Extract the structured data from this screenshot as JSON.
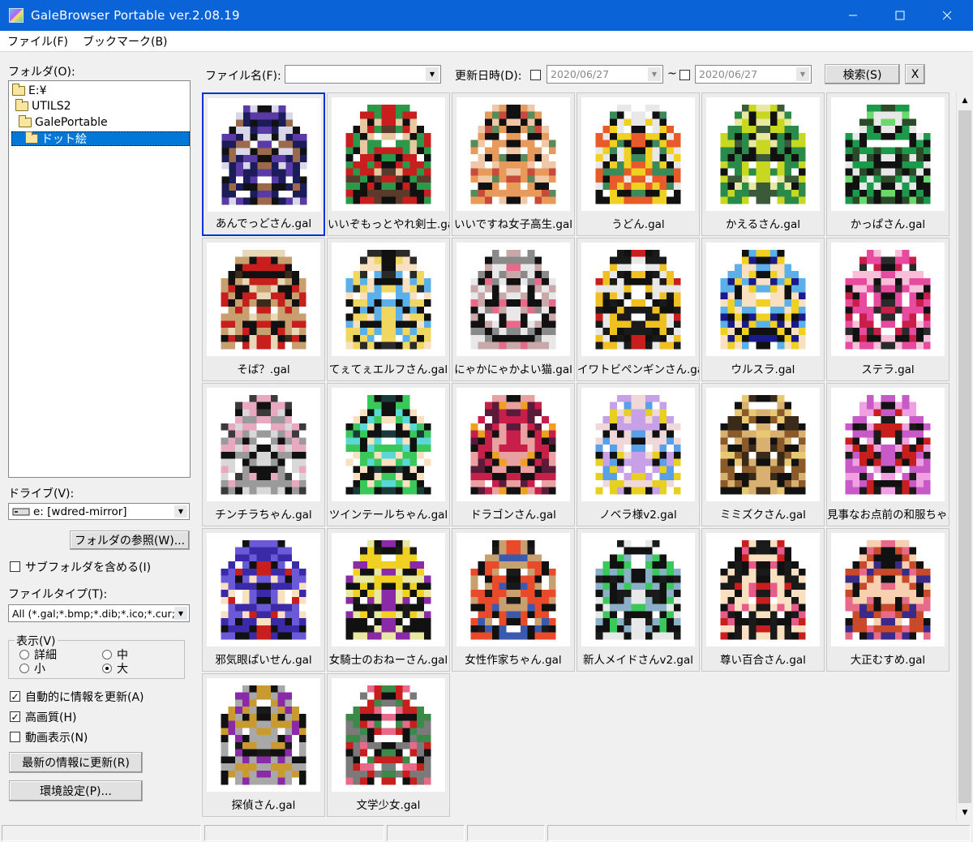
{
  "window": {
    "title": "GaleBrowser Portable ver.2.08.19",
    "minimize": "—",
    "maximize": "☐",
    "close": "✕"
  },
  "menu": [
    "ファイル(F)",
    "ブックマーク(B)"
  ],
  "left": {
    "folder_label": "フォルダ(O):",
    "tree": [
      "E:¥",
      "UTILS2",
      "GalePortable",
      "ドット絵"
    ],
    "drive_label": "ドライブ(V):",
    "drive_value": "e: [wdred-mirror]",
    "browse_button": "フォルダの参照(W)...",
    "subfolders_label": "サブフォルダを含める(I)",
    "filetype_label": "ファイルタイプ(T):",
    "filetype_value": "All (*.gal;*.bmp;*.dib;*.ico;*.cur;*",
    "display_group": "表示(V)",
    "display_options": {
      "detail": "詳細",
      "small": "小",
      "medium": "中",
      "large": "大"
    },
    "auto_update": "自動的に情報を更新(A)",
    "hq": "高画質(H)",
    "animation": "動画表示(N)",
    "refresh_button": "最新の情報に更新(R)",
    "settings_button": "環境設定(P)..."
  },
  "search": {
    "filename_label": "ファイル名(F):",
    "date_label": "更新日時(D):",
    "date_from": "2020/06/27",
    "tilde": "~",
    "date_to": "2020/06/27",
    "search_button": "検索(S)",
    "clear_button": "X"
  },
  "files": [
    {
      "name": "あんでっどさん.gal",
      "colors": [
        "#1c1c5a",
        "#5a3aa6",
        "#d8d8e8",
        "#9a6a4a"
      ]
    },
    {
      "name": "いいぞもっとやれ剣士.gal",
      "colors": [
        "#c81e1e",
        "#2a9a4a",
        "#e8c8a0",
        "#5a3a2a"
      ]
    },
    {
      "name": "いいですね女子高生.gal",
      "colors": [
        "#e89a5a",
        "#f0c8a8",
        "#5a8a5a",
        "#c84a3a"
      ]
    },
    {
      "name": "うどん.gal",
      "colors": [
        "#f0d020",
        "#e85a2a",
        "#3a8a5a",
        "#e8e8e8"
      ]
    },
    {
      "name": "かえるさん.gal",
      "colors": [
        "#2a8a4a",
        "#c8d820",
        "#e8e8a0",
        "#3a5a3a"
      ]
    },
    {
      "name": "かっぱさん.gal",
      "colors": [
        "#1a9a4a",
        "#6ad86a",
        "#e8e8e8",
        "#2a4a2a"
      ]
    },
    {
      "name": "そば？.gal",
      "colors": [
        "#c81e1e",
        "#c8a070",
        "#e8d8b8",
        "#3a2a1a"
      ]
    },
    {
      "name": "てぇてぇエルフさん.gal",
      "colors": [
        "#f0d860",
        "#5ab0e8",
        "#f8e0c0",
        "#2a2a2a"
      ]
    },
    {
      "name": "にゃかにゃかよい猫.gal",
      "colors": [
        "#e8e8e8",
        "#c8a8a8",
        "#8a8a8a",
        "#e86a8a"
      ]
    },
    {
      "name": "イワトビペンギンさん.gal",
      "colors": [
        "#1a1a1a",
        "#f0c020",
        "#e8e8e8",
        "#c81e1e"
      ]
    },
    {
      "name": "ウルスラ.gal",
      "colors": [
        "#f0d020",
        "#5ab0e8",
        "#f8e0c0",
        "#1a1a8a"
      ]
    },
    {
      "name": "ステラ.gal",
      "colors": [
        "#e84aa0",
        "#f8c0d8",
        "#c81e4a",
        "#2a2a2a"
      ]
    },
    {
      "name": "チンチラちゃん.gal",
      "colors": [
        "#9a9a9a",
        "#d8d8d8",
        "#e8a8c0",
        "#3a3a3a"
      ]
    },
    {
      "name": "ツインテールちゃん.gal",
      "colors": [
        "#3ac85a",
        "#5ad8d8",
        "#f8e0c0",
        "#1a3a3a"
      ]
    },
    {
      "name": "ドラゴンさん.gal",
      "colors": [
        "#c81e4a",
        "#e8a0a0",
        "#5a1a3a",
        "#f0a020"
      ]
    },
    {
      "name": "ノベラ様v2.gal",
      "colors": [
        "#c8a0e8",
        "#f0d8d8",
        "#e8d020",
        "#5aa0e8"
      ]
    },
    {
      "name": "ミミズクさん.gal",
      "colors": [
        "#8a5a2a",
        "#d8b070",
        "#3a2a1a",
        "#e8c870"
      ]
    },
    {
      "name": "見事なお点前の和服ちゃん.gal",
      "colors": [
        "#c85ac8",
        "#f0a0e0",
        "#c81e1e",
        "#1a1a1a"
      ]
    },
    {
      "name": "邪気眼ぱいせん.gal",
      "colors": [
        "#3a2aa8",
        "#6a5ad8",
        "#f8e0c0",
        "#c81e1e"
      ]
    },
    {
      "name": "女騎士のおねーさん.gal",
      "colors": [
        "#f0d020",
        "#e8e8a0",
        "#8a2aa8",
        "#1a1a1a"
      ]
    },
    {
      "name": "女性作家ちゃん.gal",
      "colors": [
        "#e84a2a",
        "#c8a070",
        "#3a5ab0",
        "#1a1a1a"
      ]
    },
    {
      "name": "新人メイドさんv2.gal",
      "colors": [
        "#8ab0c8",
        "#e8e8e8",
        "#3ac85a",
        "#1a1a1a"
      ]
    },
    {
      "name": "尊い百合さん.gal",
      "colors": [
        "#1a1a1a",
        "#f8e0c0",
        "#e85a8a",
        "#c81e1e"
      ]
    },
    {
      "name": "大正むすめ.gal",
      "colors": [
        "#c84a2a",
        "#f8d0b0",
        "#3a2a8a",
        "#e86a8a"
      ]
    },
    {
      "name": "探偵さん.gal",
      "colors": [
        "#c89a30",
        "#a8a8a8",
        "#8a2aa8",
        "#1a1a1a"
      ]
    },
    {
      "name": "文学少女.gal",
      "colors": [
        "#7a7a7a",
        "#c81e1e",
        "#3a8a4a",
        "#e86a8a"
      ]
    }
  ]
}
